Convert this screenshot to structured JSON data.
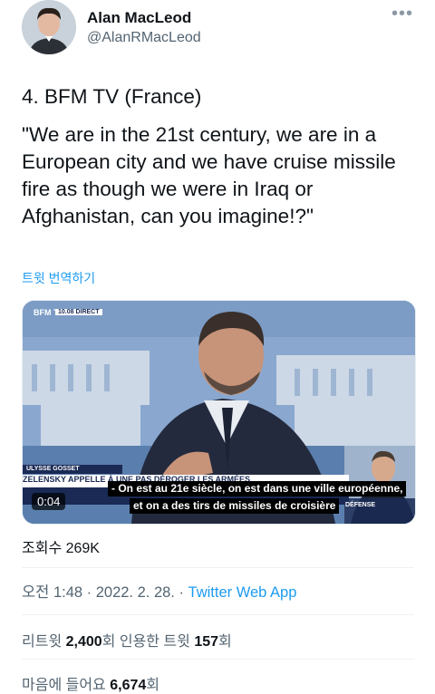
{
  "author": {
    "name": "Alan MacLeod",
    "handle": "@AlanRMacLeod",
    "more_icon": "more-dots-icon"
  },
  "tweet": {
    "title": "4. BFM TV (France)",
    "quote": "\"We are in the 21st century, we are in a European city and we have cruise missile fire as though we were in Iraq or Afghanistan, can you imagine!?\"",
    "translate_label": "트윗 번역하기"
  },
  "media": {
    "channel": "BFM TV",
    "live_label": "10.08  DIRECT",
    "lower_third_name": "ULYSSE GOSSET",
    "lower_third_headline": "ZELENSKY APPELLE À UNE PAS DÉROGER LES ARMÉES",
    "inset_label": "DÉFENSE",
    "subtitle_line1": "- On est au 21e siècle, on est dans une ville européenne,",
    "subtitle_line2": "et on a des tirs de missiles de croisière",
    "time_remaining": "0:04"
  },
  "views": "조회수 269K",
  "meta": {
    "time": "오전 1:48 · 2022. 2. 28. · ",
    "source": "Twitter Web App"
  },
  "stats": {
    "retweet_label": "리트윗 ",
    "retweet_count": "2,400",
    "retweet_suffix": "회  인용한 트윗 ",
    "quote_count": "157",
    "quote_suffix": "회"
  },
  "likes": {
    "label": "마음에 들어요 ",
    "count": "6,674",
    "suffix": "회"
  }
}
